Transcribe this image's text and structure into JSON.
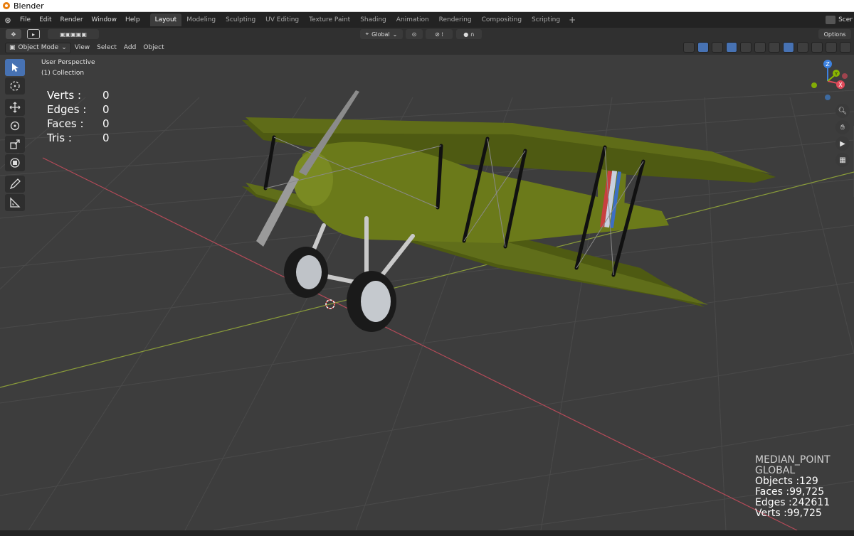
{
  "window": {
    "title": "Blender"
  },
  "menu": {
    "items": [
      "File",
      "Edit",
      "Render",
      "Window",
      "Help"
    ]
  },
  "workspaces": {
    "tabs": [
      "Layout",
      "Modeling",
      "Sculpting",
      "UV Editing",
      "Texture Paint",
      "Shading",
      "Animation",
      "Rendering",
      "Compositing",
      "Scripting"
    ],
    "active": "Layout",
    "add_label": "+"
  },
  "scene": {
    "label": "Scer"
  },
  "tool_header": {
    "transform_orientation": "Global",
    "options_label": "Options"
  },
  "view_header": {
    "mode": "Object Mode",
    "menus": [
      "View",
      "Select",
      "Add",
      "Object"
    ]
  },
  "viewport": {
    "perspective": "User Perspective",
    "collection": "(1) Collection"
  },
  "stats": [
    {
      "label": "Verts :",
      "value": "0"
    },
    {
      "label": "Edges :",
      "value": "0"
    },
    {
      "label": "Faces :",
      "value": "0"
    },
    {
      "label": "Tris :",
      "value": "0"
    }
  ],
  "right_stats": {
    "pivot": "MEDIAN_POINT",
    "orientation": "GLOBAL",
    "objects": "Objects :129",
    "faces": "Faces :99,725",
    "edges": "Edges :242611",
    "verts": "Verts :99,725"
  },
  "gizmo": {
    "x": "X",
    "y": "Y",
    "z": "Z"
  },
  "colors": {
    "accent": "#4772b3",
    "x_axis": "#e04a5a",
    "y_axis": "#8ab800",
    "z_axis": "#3d82e0",
    "aircraft": "#6b7a1a"
  }
}
